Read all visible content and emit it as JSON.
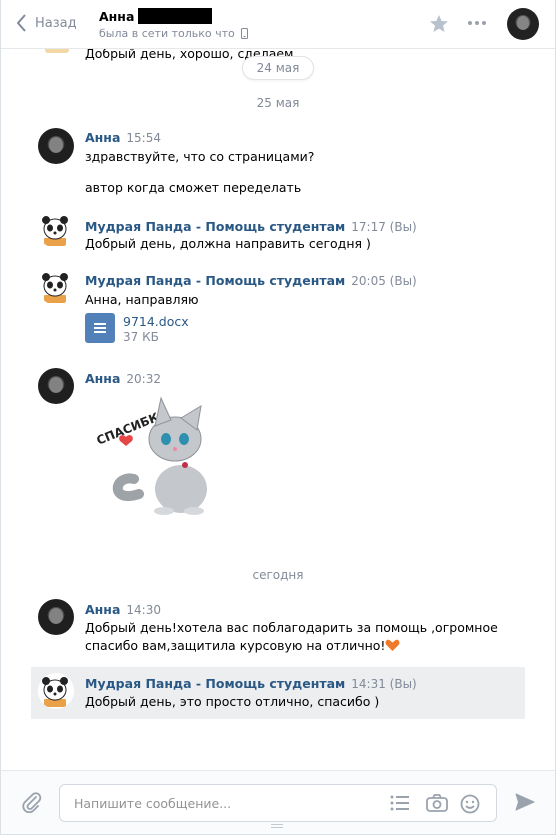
{
  "header": {
    "back_label": "Назад",
    "peer_name": "Анна",
    "peer_status": "была в сети только что"
  },
  "messages_area": {
    "top_fragment_text": "Добрый день, хорошо, сделаем",
    "date_pill": "24 мая",
    "separator_1": "25 мая",
    "separator_2": "сегодня",
    "groups": [
      {
        "author": "Анна",
        "time": "15:54",
        "lines": [
          "здравствуйте, что со страницами?",
          "автор когда сможет переделать"
        ]
      },
      {
        "author": "Мудрая Панда - Помощь студентам",
        "time": "17:17",
        "you": "(Вы)",
        "lines": [
          "Добрый день, должна направить сегодня )"
        ]
      },
      {
        "author": "Мудрая Панда - Помощь студентам",
        "time": "20:05",
        "you": "(Вы)",
        "lines": [
          "Анна, направляю"
        ],
        "doc": {
          "name": "9714.docx",
          "size": "37 КБ"
        }
      },
      {
        "author": "Анна",
        "time": "20:32",
        "sticker_text": "СПАСИБКИ"
      },
      {
        "author": "Анна",
        "time": "14:30",
        "lines": [
          "Добрый день!хотела вас поблагодарить за помощь ,огромное",
          "спасибо вам,защитила курсовую на отлично!"
        ]
      },
      {
        "author": "Мудрая Панда - Помощь студентам",
        "time": "14:31",
        "you": "(Вы)",
        "lines": [
          "Добрый день, это просто отлично, спасибо )"
        ]
      }
    ]
  },
  "composer": {
    "placeholder": "Напишите сообщение..."
  },
  "icons": [
    "chevron-left-icon",
    "phone-icon",
    "star-icon",
    "more-icon",
    "attach-icon",
    "list-icon",
    "camera-icon",
    "emoji-icon",
    "send-icon",
    "document-icon",
    "heart-icon"
  ],
  "colors": {
    "link": "#2a5885",
    "muted": "#828a99",
    "doc": "#5181b8",
    "selected_bg": "#edeef0",
    "heart": "#e64646"
  }
}
